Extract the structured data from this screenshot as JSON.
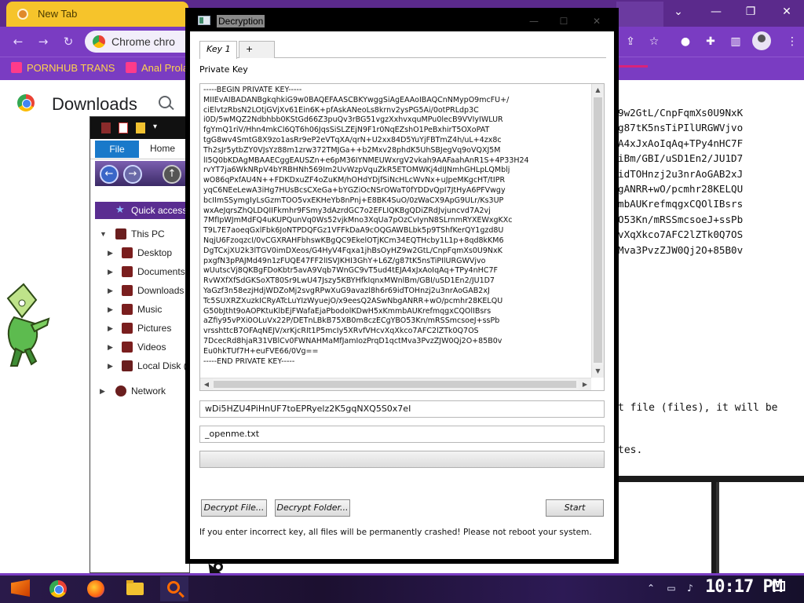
{
  "browser": {
    "tab_title": "New Tab",
    "omnibox_text": "Chrome  chro",
    "bookmarks": [
      "PORNHUB TRANS",
      "Anal Prola"
    ],
    "page_title": "Downloads"
  },
  "background_console": {
    "lines": [
      "9w2GtL/CnpFqmXs0U9NxK",
      "g87tK5nsTiPIlURGWVjvo",
      "A4xJxAoIqAq+TPy4nHC7F",
      "iBm/GBI/uSD1En2/JU1D7",
      "idTOHnzj2u3nrAoGAB2xJ",
      "gANRR+wO/pcmhr28KELQU",
      "mbAUKrefmqgxCQOlIBsrs",
      "O53Kn/mRSSmcsoeJ+ssPb",
      "vXqXkco7AFC2lZTk0Q7OS",
      "Mva3PvzZJW0Qj2O+85B0v"
    ],
    "line_files": "t file (files), it will be",
    "line_bytes": "tes."
  },
  "explorer": {
    "file_tab": "File",
    "home_tab": "Home",
    "quick_access": "Quick access",
    "tree": [
      "This PC",
      "Desktop",
      "Documents",
      "Downloads",
      "Music",
      "Pictures",
      "Videos",
      "Local Disk (C",
      "Network"
    ]
  },
  "dialog": {
    "title": "Decryption",
    "tabs": [
      "Key 1",
      "+"
    ],
    "private_key_label": "Private Key",
    "private_key": "-----BEGIN PRIVATE KEY-----\nMIIEvAIBADANBgkqhkiG9w0BAQEFAASCBKYwggSiAgEAAoIBAQCnNMypO9mcFU+/\nciElvtzRbsN2LOtjGVjXv61Ein6K+pfAskANeoLs8krnv2ysPG5Ai/0otPRLdp3C\ni0D/5wMQZ2Ndbhbb0KStGd66Z3puQv3rBG51vgzXxhvxquMPu0lecB9VVIyIWLUR\nfgYmQ1riV/Hhn4mkCl6QT6h06JqsSiSLZEjN9F1r0NqEZshO1PeBxhirT5OXoPAT\ntgG8wv4SmtG8X9zo1asRr9eP2eVTqXA/qrN+U2xx84D5YuYjFBTmZ4h/uL+4zx8c\nTh2sJr5ytbZY0VJsYz88m1zrw372TMJGa++b2Mxv28phdK5UhSBJegVq9oVQXJ5M\nlI5Q0bKDAgMBAAECggEAUSZn+e6pM36IYNMEUWxrgV2vkah9AAFaahAnR1S+4P33H24\nrvYT7ja6WkNRpV4bYRBHNh569Im2UvWzpVquZkR5ETOMWKj4dIJNmhGHLpLQMblj\nwO86qPxfAU4N++FDKDxuZF4oZuKM/hOHdYDjfSiNcHLcWvNx+uJpeMKgcHT/tIPR\nyqC6NEeLewA3iHg7HUsBcsCXeGa+bYGZiOcNSrOWaT0fYDDvQpI7JtHyA6PFVwgy\nbcIImSSymgIyLsGzmTOO5vxEKHeYb8nPnj+E8BK4SuO/0zWaCX9ApG9ULr/Ks3UP\nwxAeJqrsZhQLDQIIFkmhr9FSmy3dAzrdGC7o2EFLIQKBgQDiZRdJvjuncvd7A2vj\n7MfIpWJmMdFQ4uKUPQunVq0Ws52vjkMno3XqUa7pOzCvIynN8SLrnmRYXEWxgKXc\nT9L7E7aoeqGxlFbk6JoNTPDQFGz1VFFkDaA9cOQGAWBLbk5p9TShfKerQY1gzd8U\nNqjU6FzoqzcI/0vCGXRAHFbhswKBgQC9EkelOTjKCm34EQTHcby1L1p+8qd8kKM6\nDgTCxjXU2k3lTGV0imDXeos/G4HyV4Fqxa1jhBsOyHZ9w2GtL/CnpFqmXs0U9NxK\npxgfN3pPAJMd49n1zFUQE47FF2lISVJKHI3GhY+L6Z/g87tK5nsTiPIlURGWVjvo\nwUutscVj8QKBgFDoKbtr5avA9Vqb7WnGC9vT5ud4tEJA4xJxAoIqAq+TPy4nHC7F\nRvWXfXfSdGKSoXT80Sr9LwU47Jszy5KBYHfkIqnxMWnlBm/GBI/uSD1En2/JU1D7\nYaGzf3n58ezjHdjWDZoMj2svgRPwXuG9avazl8h6r69idTOHnzj2u3nrAoGAB2xJ\nTc5SUXRZXuzkICRyATcLuYIzWyuejO/x9eesQ2ASwNbgANRR+wO/pcmhr28KELQU\nG50bJtht9oAOPKtuKlbEjFWafaEjaPbodolKDwH5xKmmbAUKrefmqgxCQOlIBsrs\naZfiy95vPXi0OLuVx22P/DETnLBkB75XB0m8czECgYBO53Kn/mRSSmcsoeJ+ssPb\nvrsshttcB7OFAqNEJV/xrKjcRIt1P5mcIy5XRvfVHcvXqXkco7AFC2lZTk0Q7OS\n7DcecRd8hjaR31VBlCv0FWNAHMaMfJamIozPrqD1qctMva3PvzZJW0Qj2O+85B0v\nEu0hkTUf7H+euFVE66/0Vg==\n-----END PRIVATE KEY-----",
    "key_id": "wDi5HZU4PiHnUF7toEPRyelz2K5gqNXQ5S0x7eI",
    "filename": "_openme.txt",
    "progress": 0,
    "buttons": {
      "decrypt_file": "Decrypt File...",
      "decrypt_folder": "Decrypt Folder...",
      "start": "Start"
    },
    "warning": "If you enter incorrect key, all files will be permanently crashed! Please not reboot your system."
  },
  "taskbar": {
    "clock": "10:17 PM"
  },
  "colors": {
    "browser_purple": "#7a3cc2",
    "tab_yellow": "#f6c42b",
    "progress_green": "#06b025"
  }
}
